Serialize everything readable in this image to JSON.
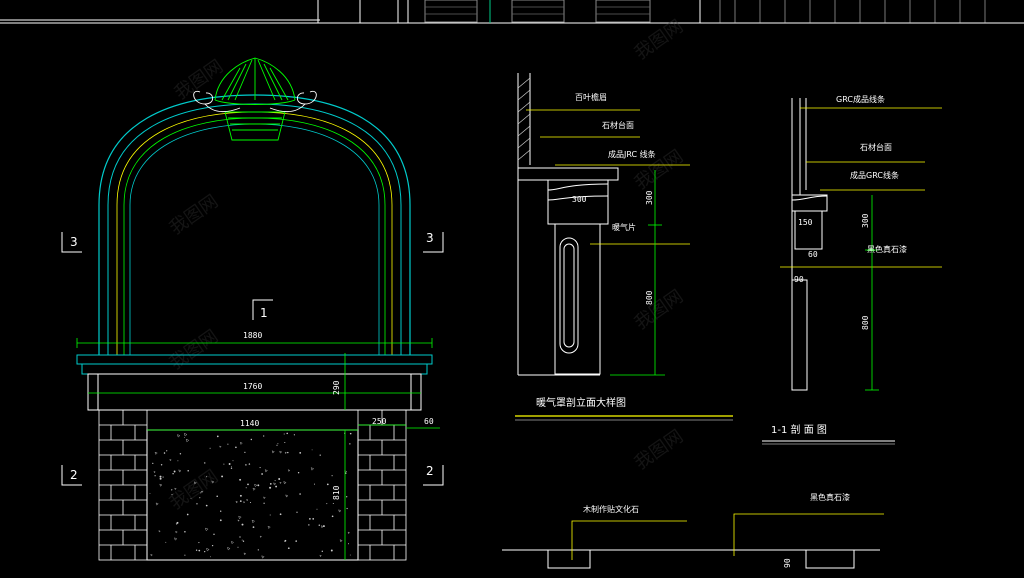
{
  "elevation": {
    "dimensions": {
      "total_width": "1880",
      "inner_width": "1760",
      "opening_width": "1140",
      "cap_height": "290",
      "lower_height": "810",
      "side_width": "250",
      "offset": "60"
    },
    "section_markers": {
      "top_left": "3",
      "top_right": "3",
      "bottom_left": "2",
      "bottom_right": "2",
      "center": "1"
    }
  },
  "detail": {
    "labels": {
      "louver_cornice": "百叶檐眉",
      "stone_countertop": "石材台面",
      "grc_moulding": "成品JRC 线条",
      "radiator_panel": "暖气片"
    },
    "dims": {
      "d300a": "300",
      "d300b": "300",
      "d800": "800"
    },
    "title": "暖气罩剖立面大样图"
  },
  "section": {
    "labels": {
      "grc_moulding_top": "GRC成品线条",
      "stone_countertop": "石材台面",
      "grc_moulding": "成品GRC线条",
      "black_paint": "黑色真石漆"
    },
    "dims": {
      "d150": "150",
      "d60": "60",
      "d90": "90",
      "d300": "300",
      "d800": "800"
    },
    "title": "1-1  剖 面 图"
  },
  "bottom": {
    "labels": {
      "wood_stone": "木制作贴文化石",
      "black_paint": "黑色真石漆"
    },
    "dims": {
      "d90": "90"
    }
  }
}
